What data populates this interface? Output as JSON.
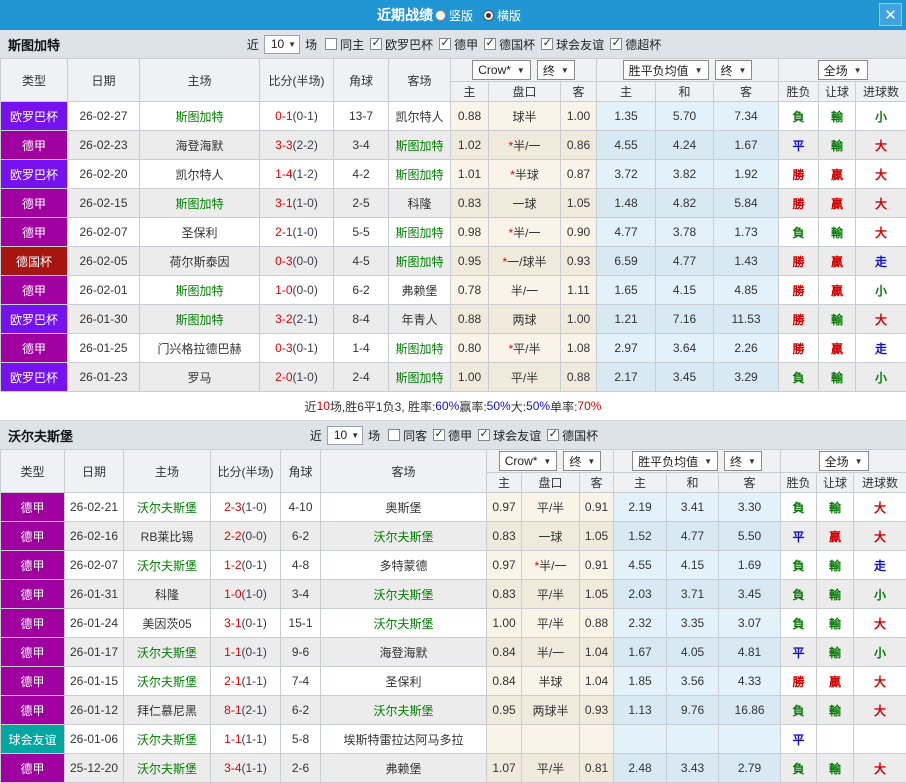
{
  "titlebar": {
    "title": "近期战绩",
    "radio_vertical": "竖版",
    "radio_horizontal": "横版",
    "selected": "横版",
    "close": "✕"
  },
  "colors": {
    "topbar": "#2095d3",
    "badges": {
      "europa": "#7612ee",
      "bundesliga": "#a000a0",
      "cup": "#a61510",
      "friendly": "#00a6a0"
    },
    "flags": {
      "red": "#d40000",
      "blue": "#1111cc",
      "green": "#067a06"
    },
    "focus_team": "#008000",
    "score": "#e60000"
  },
  "columns": {
    "type": "类型",
    "date": "日期",
    "home": "主场",
    "score": "比分(半场)",
    "corner": "角球",
    "away": "客场",
    "odds_home": "主",
    "odds_line": "盘口",
    "odds_away": "客",
    "avg_home": "主",
    "avg_draw": "和",
    "avg_away": "客",
    "result": "胜负",
    "handicap": "让球",
    "goals": "进球数"
  },
  "selects": {
    "bookmaker": "Crow*",
    "final": "终",
    "avg": "胜平负均值",
    "avg_final": "终",
    "scope": "全场",
    "arrow": "▼"
  },
  "sections": [
    {
      "team": "斯图加特",
      "filters": {
        "near": "近",
        "count": "10",
        "games": "场",
        "same": "同主",
        "same_checked": false,
        "leagues": [
          {
            "label": "欧罗巴杯",
            "checked": true
          },
          {
            "label": "德甲",
            "checked": true
          },
          {
            "label": "德国杯",
            "checked": true
          },
          {
            "label": "球会友谊",
            "checked": true
          },
          {
            "label": "德超杯",
            "checked": true
          }
        ]
      },
      "rows": [
        {
          "badge": "europa",
          "type": "欧罗巴杯",
          "date": "26-02-27",
          "home": "斯图加特",
          "hf": true,
          "score": "0-1",
          "half": "(0-1)",
          "corner": "13-7",
          "away": "凯尔特人",
          "af": false,
          "o": [
            "0.88",
            "球半",
            "1.00"
          ],
          "a": [
            "1.35",
            "5.70",
            "7.34"
          ],
          "res": [
            "負",
            "green"
          ],
          "hcp": [
            "輸",
            "green"
          ],
          "goal": [
            "小",
            "green"
          ]
        },
        {
          "badge": "bundesliga",
          "type": "德甲",
          "date": "26-02-23",
          "home": "海登海默",
          "hf": false,
          "score": "3-3",
          "half": "(2-2)",
          "corner": "3-4",
          "away": "斯图加特",
          "af": true,
          "o": [
            "1.02",
            "*半/一",
            "0.86"
          ],
          "a": [
            "4.55",
            "4.24",
            "1.67"
          ],
          "res": [
            "平",
            "blue"
          ],
          "hcp": [
            "輸",
            "green"
          ],
          "goal": [
            "大",
            "red"
          ]
        },
        {
          "badge": "europa",
          "type": "欧罗巴杯",
          "date": "26-02-20",
          "home": "凯尔特人",
          "hf": false,
          "score": "1-4",
          "half": "(1-2)",
          "corner": "4-2",
          "away": "斯图加特",
          "af": true,
          "o": [
            "1.01",
            "*半球",
            "0.87"
          ],
          "a": [
            "3.72",
            "3.82",
            "1.92"
          ],
          "res": [
            "勝",
            "red"
          ],
          "hcp": [
            "贏",
            "red"
          ],
          "goal": [
            "大",
            "red"
          ]
        },
        {
          "badge": "bundesliga",
          "type": "德甲",
          "date": "26-02-15",
          "home": "斯图加特",
          "hf": true,
          "score": "3-1",
          "half": "(1-0)",
          "corner": "2-5",
          "away": "科隆",
          "af": false,
          "o": [
            "0.83",
            "一球",
            "1.05"
          ],
          "a": [
            "1.48",
            "4.82",
            "5.84"
          ],
          "res": [
            "勝",
            "red"
          ],
          "hcp": [
            "贏",
            "red"
          ],
          "goal": [
            "大",
            "red"
          ]
        },
        {
          "badge": "bundesliga",
          "type": "德甲",
          "date": "26-02-07",
          "home": "圣保利",
          "hf": false,
          "score": "2-1",
          "half": "(1-0)",
          "corner": "5-5",
          "away": "斯图加特",
          "af": true,
          "o": [
            "0.98",
            "*半/一",
            "0.90"
          ],
          "a": [
            "4.77",
            "3.78",
            "1.73"
          ],
          "res": [
            "負",
            "green"
          ],
          "hcp": [
            "輸",
            "green"
          ],
          "goal": [
            "大",
            "red"
          ]
        },
        {
          "badge": "cup",
          "type": "德国杯",
          "date": "26-02-05",
          "home": "荷尔斯泰因",
          "hf": false,
          "score": "0-3",
          "half": "(0-0)",
          "corner": "4-5",
          "away": "斯图加特",
          "af": true,
          "o": [
            "0.95",
            "*一/球半",
            "0.93"
          ],
          "a": [
            "6.59",
            "4.77",
            "1.43"
          ],
          "res": [
            "勝",
            "red"
          ],
          "hcp": [
            "贏",
            "red"
          ],
          "goal": [
            "走",
            "blue"
          ]
        },
        {
          "badge": "bundesliga",
          "type": "德甲",
          "date": "26-02-01",
          "home": "斯图加特",
          "hf": true,
          "score": "1-0",
          "half": "(0-0)",
          "corner": "6-2",
          "away": "弗赖堡",
          "af": false,
          "o": [
            "0.78",
            "半/一",
            "1.11"
          ],
          "a": [
            "1.65",
            "4.15",
            "4.85"
          ],
          "res": [
            "勝",
            "red"
          ],
          "hcp": [
            "贏",
            "red"
          ],
          "goal": [
            "小",
            "green"
          ]
        },
        {
          "badge": "europa",
          "type": "欧罗巴杯",
          "date": "26-01-30",
          "home": "斯图加特",
          "hf": true,
          "score": "3-2",
          "half": "(2-1)",
          "corner": "8-4",
          "away": "年青人",
          "af": false,
          "o": [
            "0.88",
            "两球",
            "1.00"
          ],
          "a": [
            "1.21",
            "7.16",
            "11.53"
          ],
          "res": [
            "勝",
            "red"
          ],
          "hcp": [
            "輸",
            "green"
          ],
          "goal": [
            "大",
            "red"
          ]
        },
        {
          "badge": "bundesliga",
          "type": "德甲",
          "date": "26-01-25",
          "home": "门兴格拉德巴赫",
          "hf": false,
          "score": "0-3",
          "half": "(0-1)",
          "corner": "1-4",
          "away": "斯图加特",
          "af": true,
          "o": [
            "0.80",
            "*平/半",
            "1.08"
          ],
          "a": [
            "2.97",
            "3.64",
            "2.26"
          ],
          "res": [
            "勝",
            "red"
          ],
          "hcp": [
            "贏",
            "red"
          ],
          "goal": [
            "走",
            "blue"
          ]
        },
        {
          "badge": "europa",
          "type": "欧罗巴杯",
          "date": "26-01-23",
          "home": "罗马",
          "hf": false,
          "score": "2-0",
          "half": "(1-0)",
          "corner": "2-4",
          "away": "斯图加特",
          "af": true,
          "o": [
            "1.00",
            "平/半",
            "0.88"
          ],
          "a": [
            "2.17",
            "3.45",
            "3.29"
          ],
          "res": [
            "負",
            "green"
          ],
          "hcp": [
            "輸",
            "green"
          ],
          "goal": [
            "小",
            "green"
          ]
        }
      ],
      "summary": [
        {
          "t": "近"
        },
        {
          "t": "10",
          "c": "#d40000"
        },
        {
          "t": "场,胜6平1负3, 胜率:"
        },
        {
          "t": "60%",
          "c": "#1111cc"
        },
        {
          "t": " 赢率:"
        },
        {
          "t": "50%",
          "c": "#1111cc"
        },
        {
          "t": " 大:"
        },
        {
          "t": "50%",
          "c": "#1111cc"
        },
        {
          "t": " 单率:"
        },
        {
          "t": "70%",
          "c": "#d40000"
        }
      ]
    },
    {
      "team": "沃尔夫斯堡",
      "filters": {
        "near": "近",
        "count": "10",
        "games": "场",
        "same": "同客",
        "same_checked": false,
        "leagues": [
          {
            "label": "德甲",
            "checked": true
          },
          {
            "label": "球会友谊",
            "checked": true
          },
          {
            "label": "德国杯",
            "checked": true
          }
        ]
      },
      "rows": [
        {
          "badge": "bundesliga",
          "type": "德甲",
          "date": "26-02-21",
          "home": "沃尔夫斯堡",
          "hf": true,
          "score": "2-3",
          "half": "(1-0)",
          "corner": "4-10",
          "away": "奥斯堡",
          "af": false,
          "o": [
            "0.97",
            "平/半",
            "0.91"
          ],
          "a": [
            "2.19",
            "3.41",
            "3.30"
          ],
          "res": [
            "負",
            "green"
          ],
          "hcp": [
            "輸",
            "green"
          ],
          "goal": [
            "大",
            "red"
          ]
        },
        {
          "badge": "bundesliga",
          "type": "德甲",
          "date": "26-02-16",
          "home": "RB莱比锡",
          "hf": false,
          "score": "2-2",
          "half": "(0-0)",
          "corner": "6-2",
          "away": "沃尔夫斯堡",
          "af": true,
          "o": [
            "0.83",
            "一球",
            "1.05"
          ],
          "a": [
            "1.52",
            "4.77",
            "5.50"
          ],
          "res": [
            "平",
            "blue"
          ],
          "hcp": [
            "贏",
            "red"
          ],
          "goal": [
            "大",
            "red"
          ]
        },
        {
          "badge": "bundesliga",
          "type": "德甲",
          "date": "26-02-07",
          "home": "沃尔夫斯堡",
          "hf": true,
          "score": "1-2",
          "half": "(0-1)",
          "corner": "4-8",
          "away": "多特蒙德",
          "af": false,
          "o": [
            "0.97",
            "*半/一",
            "0.91"
          ],
          "a": [
            "4.55",
            "4.15",
            "1.69"
          ],
          "res": [
            "負",
            "green"
          ],
          "hcp": [
            "輸",
            "green"
          ],
          "goal": [
            "走",
            "blue"
          ]
        },
        {
          "badge": "bundesliga",
          "type": "德甲",
          "date": "26-01-31",
          "home": "科隆",
          "hf": false,
          "score": "1-0",
          "half": "(1-0)",
          "corner": "3-4",
          "away": "沃尔夫斯堡",
          "af": true,
          "o": [
            "0.83",
            "平/半",
            "1.05"
          ],
          "a": [
            "2.03",
            "3.71",
            "3.45"
          ],
          "res": [
            "負",
            "green"
          ],
          "hcp": [
            "輸",
            "green"
          ],
          "goal": [
            "小",
            "green"
          ]
        },
        {
          "badge": "bundesliga",
          "type": "德甲",
          "date": "26-01-24",
          "home": "美因茨05",
          "hf": false,
          "score": "3-1",
          "half": "(0-1)",
          "corner": "15-1",
          "away": "沃尔夫斯堡",
          "af": true,
          "o": [
            "1.00",
            "平/半",
            "0.88"
          ],
          "a": [
            "2.32",
            "3.35",
            "3.07"
          ],
          "res": [
            "負",
            "green"
          ],
          "hcp": [
            "輸",
            "green"
          ],
          "goal": [
            "大",
            "red"
          ]
        },
        {
          "badge": "bundesliga",
          "type": "德甲",
          "date": "26-01-17",
          "home": "沃尔夫斯堡",
          "hf": true,
          "score": "1-1",
          "half": "(0-1)",
          "corner": "9-6",
          "away": "海登海默",
          "af": false,
          "o": [
            "0.84",
            "半/一",
            "1.04"
          ],
          "a": [
            "1.67",
            "4.05",
            "4.81"
          ],
          "res": [
            "平",
            "blue"
          ],
          "hcp": [
            "輸",
            "green"
          ],
          "goal": [
            "小",
            "green"
          ]
        },
        {
          "badge": "bundesliga",
          "type": "德甲",
          "date": "26-01-15",
          "home": "沃尔夫斯堡",
          "hf": true,
          "score": "2-1",
          "half": "(1-1)",
          "corner": "7-4",
          "away": "圣保利",
          "af": false,
          "o": [
            "0.84",
            "半球",
            "1.04"
          ],
          "a": [
            "1.85",
            "3.56",
            "4.33"
          ],
          "res": [
            "勝",
            "red"
          ],
          "hcp": [
            "贏",
            "red"
          ],
          "goal": [
            "大",
            "red"
          ]
        },
        {
          "badge": "bundesliga",
          "type": "德甲",
          "date": "26-01-12",
          "home": "拜仁慕尼黑",
          "hf": false,
          "score": "8-1",
          "half": "(2-1)",
          "corner": "6-2",
          "away": "沃尔夫斯堡",
          "af": true,
          "o": [
            "0.95",
            "两球半",
            "0.93"
          ],
          "a": [
            "1.13",
            "9.76",
            "16.86"
          ],
          "res": [
            "負",
            "green"
          ],
          "hcp": [
            "輸",
            "green"
          ],
          "goal": [
            "大",
            "red"
          ]
        },
        {
          "badge": "friendly",
          "type": "球会友谊",
          "date": "26-01-06",
          "home": "沃尔夫斯堡",
          "hf": true,
          "score": "1-1",
          "half": "(1-1)",
          "corner": "5-8",
          "away": "埃斯特雷拉达阿马多拉",
          "af": false,
          "o": [
            "",
            "",
            ""
          ],
          "a": [
            "",
            "",
            ""
          ],
          "res": [
            "平",
            "blue"
          ],
          "hcp": [
            "",
            ""
          ],
          "goal": [
            "",
            ""
          ]
        },
        {
          "badge": "bundesliga",
          "type": "德甲",
          "date": "25-12-20",
          "home": "沃尔夫斯堡",
          "hf": true,
          "score": "3-4",
          "half": "(1-1)",
          "corner": "2-6",
          "away": "弗赖堡",
          "af": false,
          "o": [
            "1.07",
            "平/半",
            "0.81"
          ],
          "a": [
            "2.48",
            "3.43",
            "2.79"
          ],
          "res": [
            "負",
            "green"
          ],
          "hcp": [
            "輸",
            "green"
          ],
          "goal": [
            "大",
            "red"
          ]
        }
      ]
    }
  ]
}
